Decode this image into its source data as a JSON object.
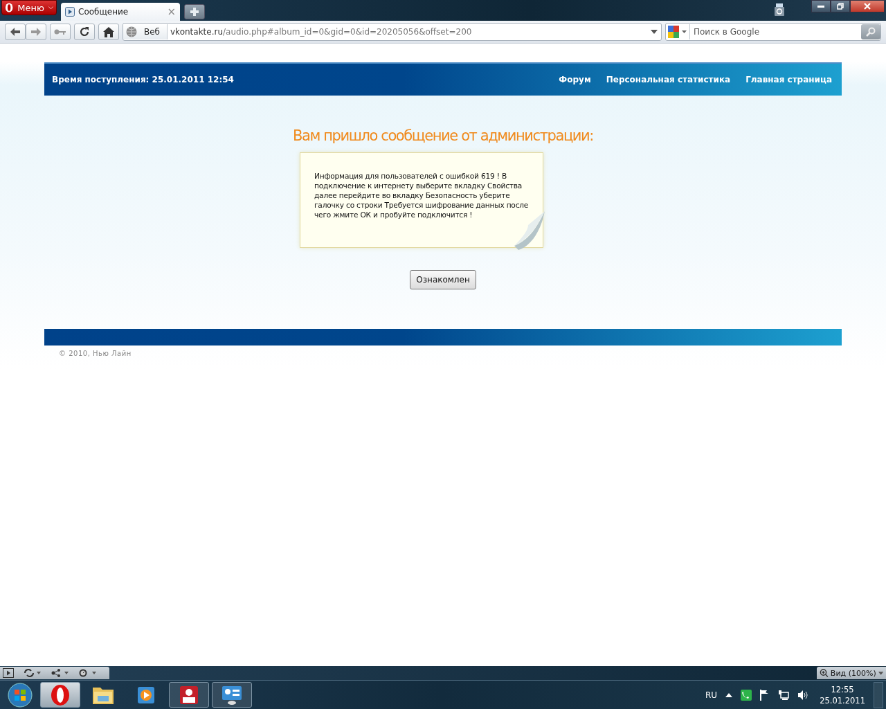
{
  "browser": {
    "menu_label": "Меню",
    "tabs": [
      {
        "title": "Сообщение",
        "selected": true,
        "close": "×"
      }
    ],
    "address": {
      "host": "vkontakte.ru",
      "path": "/audio.php#album_id=0&gid=0&id=20205056&offset=200"
    },
    "web_label": "Веб",
    "search": {
      "placeholder": "Поиск в Google"
    },
    "zoom_label": "Вид (100%)"
  },
  "page": {
    "header": {
      "arrival": "Время поступления: 25.01.2011 12:54",
      "links": [
        "Форум",
        "Персональная статистика",
        "Главная страница"
      ]
    },
    "title": "Вам пришло сообщение от администрации:",
    "message": "Информация для пользователей с ошибкой 619 ! В подключение к интернету выберите вкладку Свойства далее перейдите во вкладку Безопасность уберите галочку со строки Требуется шифрование данных после чего жмите ОК и пробуйте подключится !",
    "button": "Ознакомлен",
    "copyright": "© 2010, Нью Лайн"
  },
  "taskbar": {
    "items": [
      {
        "kind": "opera",
        "selected": true,
        "open": true
      },
      {
        "kind": "folder",
        "selected": false,
        "open": false
      },
      {
        "kind": "media",
        "selected": false,
        "open": false
      },
      {
        "kind": "rq",
        "selected": false,
        "open": true
      },
      {
        "kind": "panel",
        "selected": false,
        "open": true
      }
    ],
    "language": "RU",
    "time": "12:55",
    "date": "25.01.2011"
  }
}
